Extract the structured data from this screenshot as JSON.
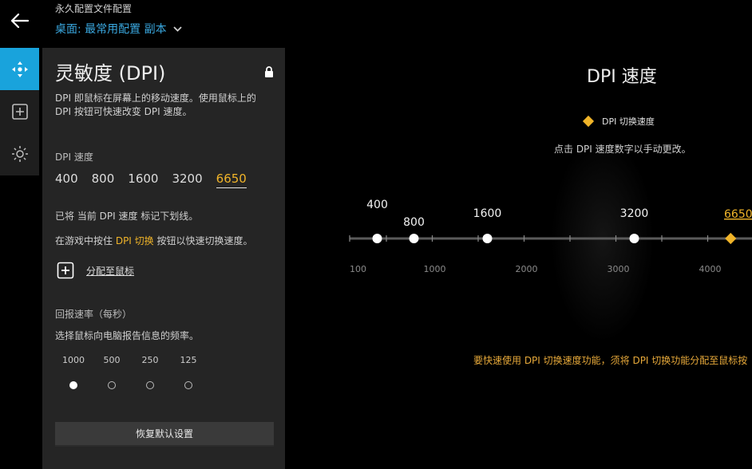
{
  "header": {
    "caption": "永久配置文件配置",
    "profile_name": "桌面: 最常用配置 副本"
  },
  "rail": {
    "items": [
      {
        "icon": "move-icon",
        "active": true
      },
      {
        "icon": "add-box-icon",
        "active": false
      },
      {
        "icon": "lighting-icon",
        "active": false
      }
    ]
  },
  "panel": {
    "title": "灵敏度 (DPI)",
    "description": "DPI 即鼠标在屏幕上的移动速度。使用鼠标上的 DPI 按钮可快速改变 DPI 速度。",
    "dpi_label": "DPI 速度",
    "dpi_levels": [
      "400",
      "800",
      "1600",
      "3200",
      "6650"
    ],
    "current_dpi": "6650",
    "note_underline": "已将 当前 DPI 速度 标记下划线。",
    "note_shift_pre": "在游戏中按住 ",
    "note_shift_hl": "DPI 切换",
    "note_shift_post": " 按钮以快速切换速度。",
    "assign_label": "分配至鼠标",
    "report_label": "回报速率（每秒）",
    "report_desc": "选择鼠标向电脑报告信息的频率。",
    "report_rates": [
      "1000",
      "500",
      "250",
      "125"
    ],
    "report_selected": "1000",
    "restore_label": "恢复默认设置"
  },
  "right": {
    "title": "DPI 速度",
    "legend_label": "DPI 切换速度",
    "hint": "点击 DPI 速度数字以手动更改。",
    "warning": "要快速使用 DPI 切换速度功能，须将 DPI 切换功能分配至鼠标按",
    "colors": {
      "accent": "#f0b429",
      "link": "#3aa8e0",
      "active_tab": "#19a3dc"
    }
  },
  "slider": {
    "axis_labels": [
      "100",
      "1000",
      "2000",
      "3000",
      "4000"
    ],
    "points": [
      {
        "value": 400,
        "label": "400"
      },
      {
        "value": 800,
        "label": "800"
      },
      {
        "value": 1600,
        "label": "1600"
      },
      {
        "value": 3200,
        "label": "3200"
      }
    ],
    "shift_value": 4250,
    "offscreen_label": "6650"
  }
}
